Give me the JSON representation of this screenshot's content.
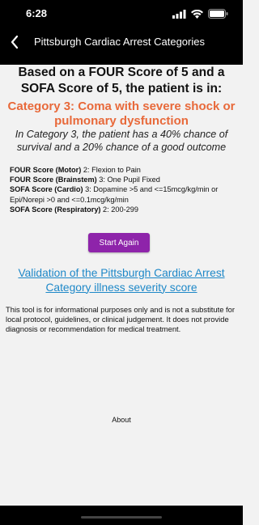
{
  "status_bar": {
    "time": "6:28"
  },
  "nav": {
    "title": "Pittsburgh Cardiac Arrest Categories"
  },
  "result": {
    "headline": "Based on a FOUR Score of 5 and a SOFA Score of 5, the patient is in:",
    "category": "Category 3: Coma with severe shock or pulmonary dysfunction",
    "chance": "In Category 3, the patient has a 40% chance of survival and a 20% chance of a good outcome"
  },
  "scores": [
    {
      "label": "FOUR Score (Motor)",
      "value": " 2: Flexion to Pain"
    },
    {
      "label": "FOUR Score (Brainstem)",
      "value": " 3: One Pupil Fixed"
    },
    {
      "label": "SOFA Score (Cardio)",
      "value": " 3: Dopamine >5 and <=15mcg/kg/min or Epi/Norepi >0 and <=0.1mcg/kg/min"
    },
    {
      "label": "SOFA Score (Respiratory)",
      "value": " 2: 200-299"
    }
  ],
  "start_again_label": "Start Again",
  "validation_link": "Validation of the Pittsburgh Cardiac Arrest Category illness severity score",
  "disclaimer": "This tool is for informational purposes only and is not a substitute for local protocol, guidelines, or clinical judgement. It does not provide diagnosis or recommendation for medical treatment.",
  "about_label": "About",
  "colors": {
    "accent": "#e8693a",
    "button": "#8e24aa",
    "link": "#1e88c8"
  }
}
